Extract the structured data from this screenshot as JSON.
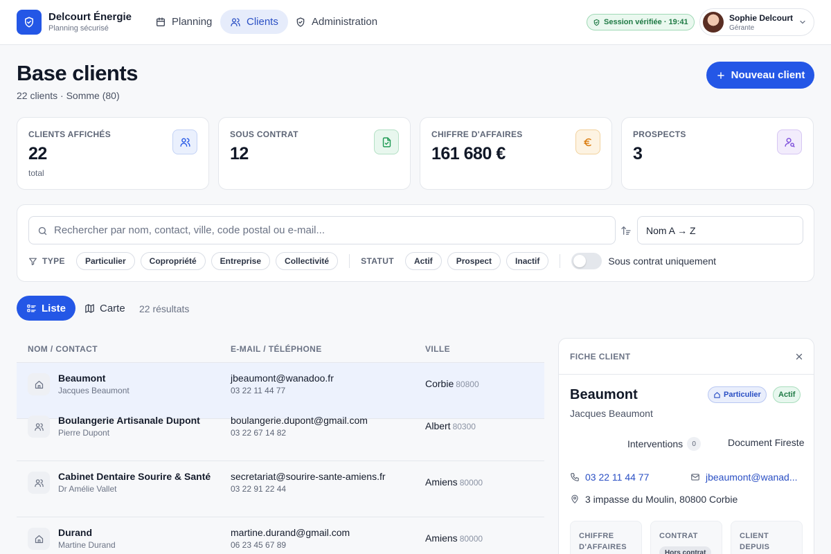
{
  "brand": {
    "name": "Delcourt Énergie",
    "subtitle": "Planning sécurisé"
  },
  "nav": [
    {
      "label": "Planning",
      "icon": "calendar-icon",
      "active": false
    },
    {
      "label": "Clients",
      "icon": "users-icon",
      "active": true
    },
    {
      "label": "Administration",
      "icon": "shield-icon",
      "active": false
    }
  ],
  "session": {
    "label": "Session vérifiée · 19:41"
  },
  "user": {
    "name": "Sophie Delcourt",
    "role": "Gérante"
  },
  "page": {
    "title": "Base clients",
    "subtitle": "22 clients · Somme (80)",
    "new_button": "Nouveau client"
  },
  "stats": [
    {
      "label": "CLIENTS AFFICHÉS",
      "value": "22",
      "note": "total",
      "icon": "users-icon",
      "color": "#2457e6"
    },
    {
      "label": "SOUS CONTRAT",
      "value": "12",
      "note": "",
      "icon": "file-check-icon",
      "color": "#1f9a55"
    },
    {
      "label": "CHIFFRE D'AFFAIRES",
      "value": "161 680 €",
      "note": "",
      "icon": "euro-icon",
      "color": "#d97706"
    },
    {
      "label": "PROSPECTS",
      "value": "3",
      "note": "",
      "icon": "user-search-icon",
      "color": "#7c4ddb"
    }
  ],
  "filters": {
    "search_placeholder": "Rechercher par nom, contact, ville, code postal ou e-mail...",
    "sort_value": "Nom A → Z",
    "type_label": "TYPE",
    "types": [
      "Particulier",
      "Copropriété",
      "Entreprise",
      "Collectivité"
    ],
    "status_label": "STATUT",
    "statuses": [
      "Actif",
      "Prospect",
      "Inactif"
    ],
    "contract_toggle_label": "Sous contrat uniquement"
  },
  "view": {
    "list_label": "Liste",
    "map_label": "Carte",
    "results": "22 résultats"
  },
  "table": {
    "headers": [
      "NOM / CONTACT",
      "E-MAIL / TÉLÉPHONE",
      "VILLE"
    ],
    "rows": [
      {
        "icon": "home-icon",
        "name": "Beaumont",
        "contact": "Jacques Beaumont",
        "email": "jbeaumont@wanadoo.fr",
        "phone": "03 22 11 44 77",
        "city": "Corbie",
        "zip": "80800",
        "selected": true
      },
      {
        "icon": "users-icon",
        "name": "Boulangerie Artisanale Dupont",
        "contact": "Pierre Dupont",
        "email": "boulangerie.dupont@gmail.com",
        "phone": "03 22 67 14 82",
        "city": "Albert",
        "zip": "80300",
        "selected": false
      },
      {
        "icon": "users-icon",
        "name": "Cabinet Dentaire Sourire & Santé",
        "contact": "Dr Amélie Vallet",
        "email": "secretariat@sourire-sante-amiens.fr",
        "phone": "03 22 91 22 44",
        "city": "Amiens",
        "zip": "80000",
        "selected": false
      },
      {
        "icon": "home-icon",
        "name": "Durand",
        "contact": "Martine Durand",
        "email": "martine.durand@gmail.com",
        "phone": "06 23 45 67 89",
        "city": "Amiens",
        "zip": "80000",
        "selected": false
      }
    ]
  },
  "detail": {
    "header": "FICHE CLIENT",
    "name": "Beaumont",
    "contact": "Jacques Beaumont",
    "type_badge": "Particulier",
    "status_badge": "Actif",
    "tabs": [
      {
        "label": "Interventions",
        "count": "0"
      },
      {
        "label": "Document Fireste"
      }
    ],
    "phone": "03 22 11 44 77",
    "email": "jbeaumont@wanad...",
    "address": "3 impasse du Moulin, 80800 Corbie",
    "cards": [
      {
        "label_1": "CHIFFRE",
        "label_2": "D'AFFAIRES",
        "badge": ""
      },
      {
        "label_1": "CONTRAT",
        "label_2": "",
        "badge": "Hors contrat"
      },
      {
        "label_1": "CLIENT",
        "label_2": "DEPUIS",
        "badge": ""
      }
    ]
  }
}
